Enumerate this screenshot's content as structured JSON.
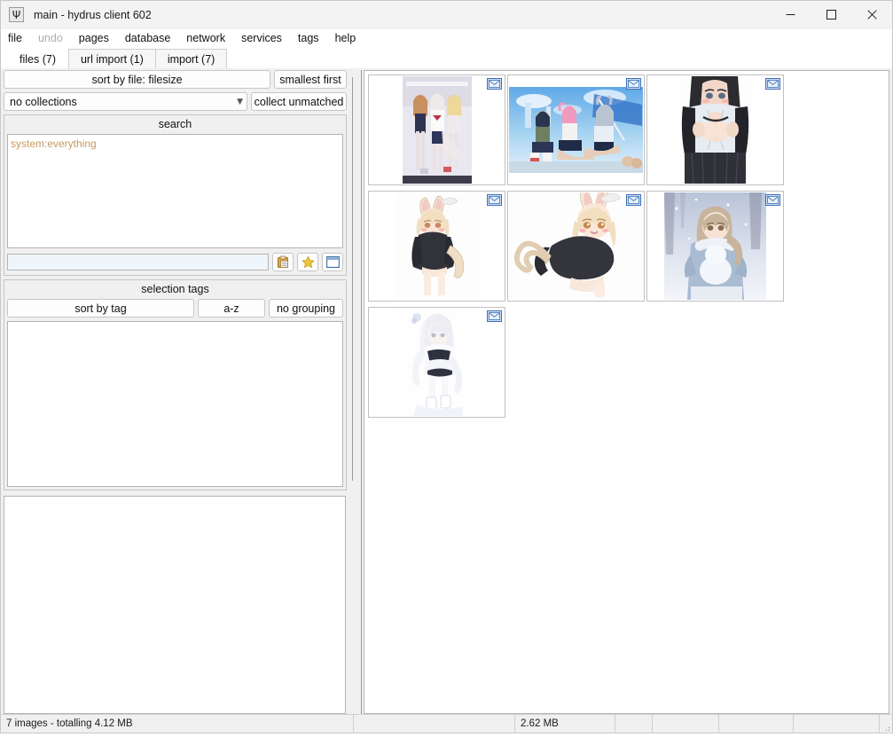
{
  "window": {
    "title": "main - hydrus client 602",
    "app_icon": "trident-icon",
    "minimize_label": "minimize",
    "maximize_label": "maximize",
    "close_label": "close"
  },
  "menu_bar": {
    "items": [
      {
        "label": "file",
        "disabled": false
      },
      {
        "label": "undo",
        "disabled": true
      },
      {
        "label": "pages",
        "disabled": false
      },
      {
        "label": "database",
        "disabled": false
      },
      {
        "label": "network",
        "disabled": false
      },
      {
        "label": "services",
        "disabled": false
      },
      {
        "label": "tags",
        "disabled": false
      },
      {
        "label": "help",
        "disabled": false
      }
    ]
  },
  "tab_bar": {
    "tabs": [
      {
        "label": "files (7)",
        "active": true
      },
      {
        "label": "url import (1)",
        "active": false
      },
      {
        "label": "import (7)",
        "active": false
      }
    ]
  },
  "left_panel": {
    "sort_button": "sort by file: filesize",
    "sort_direction_button": "smallest first",
    "collections_select": "no collections",
    "collect_button": "collect unmatched",
    "search_group": {
      "title": "search",
      "predicates": [
        "system:everything"
      ],
      "predicate_color": "#c59a5e",
      "tag_input_value": "",
      "tag_input_placeholder": "",
      "buttons": [
        {
          "name": "paste-clipboard-icon",
          "label": "clipboard"
        },
        {
          "name": "favourite-star-icon",
          "label": "favourite searches"
        },
        {
          "name": "open-window-icon",
          "label": "open search in new page"
        }
      ]
    },
    "selection_tags_group": {
      "title": "selection tags",
      "sort_button": "sort by tag",
      "order_button": "a-z",
      "grouping_button": "no grouping",
      "tags": []
    }
  },
  "thumbnails": {
    "count": 7,
    "items": [
      {
        "id": 1,
        "inbox": true,
        "alt": "three anime girls in swimsuits indoors",
        "orientation": "portrait"
      },
      {
        "id": 2,
        "inbox": true,
        "alt": "group of anime girls outdoors under blue sky",
        "orientation": "landscape"
      },
      {
        "id": 3,
        "inbox": true,
        "alt": "anime girl in school uniform close-up",
        "orientation": "portrait"
      },
      {
        "id": 4,
        "inbox": true,
        "alt": "cat-eared anime girl in black hoodie standing",
        "orientation": "portrait"
      },
      {
        "id": 5,
        "inbox": true,
        "alt": "cat-eared anime girl in black hoodie lying down",
        "orientation": "landscape"
      },
      {
        "id": 6,
        "inbox": true,
        "alt": "anime girl with scarf in snowy scene",
        "orientation": "landscape"
      },
      {
        "id": 7,
        "inbox": true,
        "alt": "white-haired anime girl in pale outfit",
        "orientation": "portrait"
      }
    ],
    "inbox_badge_icon": "envelope-icon"
  },
  "status_bar": {
    "cells": [
      "7 images - totalling 4.12 MB",
      "",
      "2.62 MB",
      "",
      "",
      "",
      "",
      ""
    ]
  },
  "colors": {
    "window_background": "#f0f0f0",
    "panel_background": "#ffffff",
    "border": "#c4c4c4",
    "predicate_orange": "#c59a5e",
    "badge_blue": "#3f6fb5",
    "badge_fill": "#cfe0f4",
    "star_gold": "#e8b830"
  }
}
